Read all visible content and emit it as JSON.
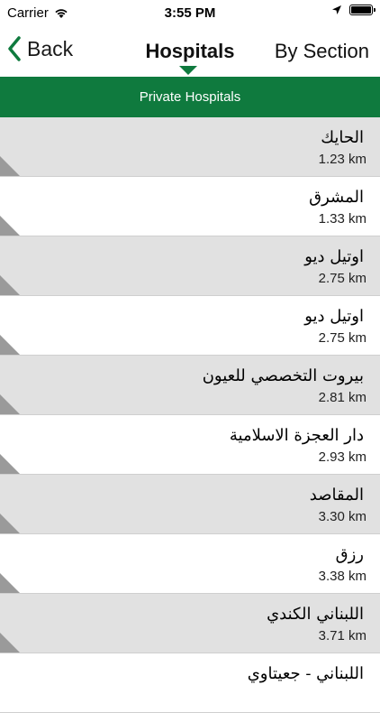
{
  "status_bar": {
    "carrier": "Carrier",
    "time": "3:55 PM"
  },
  "nav": {
    "back_label": "Back",
    "title": "Hospitals",
    "right_label": "By Section"
  },
  "section": {
    "title": "Private Hospitals"
  },
  "colors": {
    "accent": "#0f7a3e"
  },
  "hospitals": [
    {
      "name": "الحايك",
      "distance": "1.23 km"
    },
    {
      "name": "المشرق",
      "distance": "1.33 km"
    },
    {
      "name": "اوتيل ديو",
      "distance": "2.75 km"
    },
    {
      "name": "اوتيل ديو",
      "distance": "2.75 km"
    },
    {
      "name": "بيروت التخصصي للعيون",
      "distance": "2.81 km"
    },
    {
      "name": "دار العجزة الاسلامية",
      "distance": "2.93 km"
    },
    {
      "name": "المقاصد",
      "distance": "3.30 km"
    },
    {
      "name": "رزق",
      "distance": "3.38 km"
    },
    {
      "name": "اللبناني الكندي",
      "distance": "3.71 km"
    },
    {
      "name": "اللبناني - جعيتاوي",
      "distance": ""
    }
  ]
}
